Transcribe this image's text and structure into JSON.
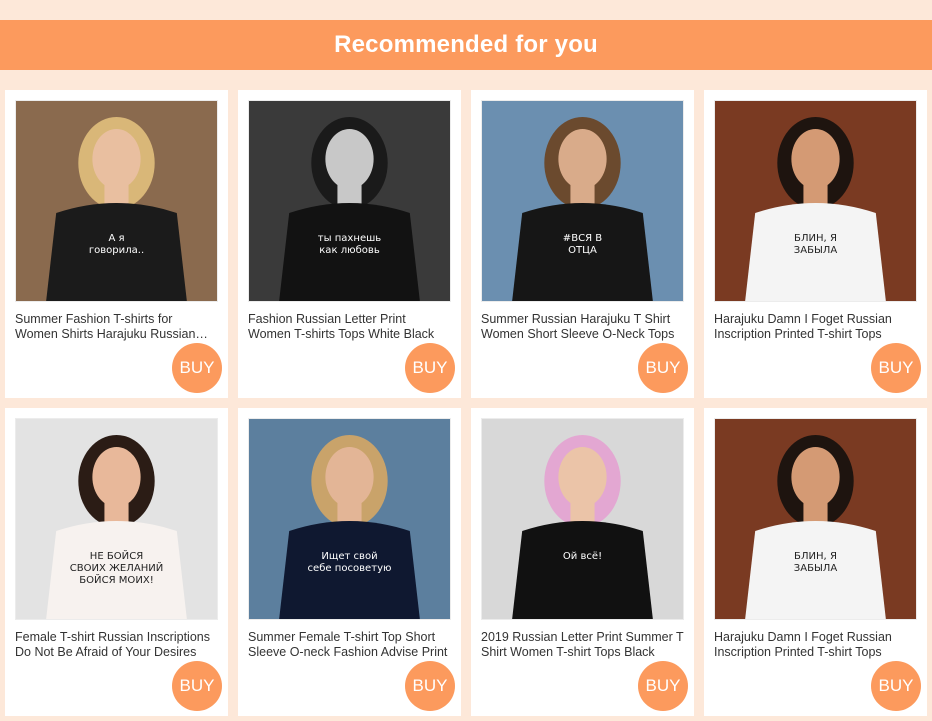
{
  "header": {
    "title": "Recommended for you"
  },
  "products": [
    {
      "title": "Summer Fashion T-shirts for Women Shirts Harajuku Russian Letter Print",
      "buy_label": "BUY",
      "print_text": "А я говорила..",
      "shirt_color": "#1b1b1b",
      "bg_color": "#8a6a4e",
      "skin_color": "#e9bfa0",
      "hair_color": "#d9b778"
    },
    {
      "title": "Fashion Russian Letter Print Women T-shirts Tops White Black",
      "buy_label": "BUY",
      "print_text": "ты пахнешь как любовь",
      "shirt_color": "#121212",
      "bg_color": "#3a3a3a",
      "skin_color": "#c8c8c8",
      "hair_color": "#1a1a1a"
    },
    {
      "title": "Summer Russian Harajuku T Shirt Women Short Sleeve O-Neck Tops",
      "buy_label": "BUY",
      "print_text": "#ВСЯ В ОТЦА",
      "shirt_color": "#161616",
      "bg_color": "#6b8fb0",
      "skin_color": "#d9ab8a",
      "hair_color": "#6b4a2e"
    },
    {
      "title": "Harajuku Damn I Foget Russian Inscription Printed T-shirt Tops",
      "buy_label": "BUY",
      "print_text": "БЛИН, Я ЗАБЫЛА",
      "shirt_color": "#f4f4f4",
      "bg_color": "#7a3a22",
      "skin_color": "#d49a74",
      "hair_color": "#1e140f"
    },
    {
      "title": "Female T-shirt Russian Inscriptions Do Not Be Afraid of Your Desires",
      "buy_label": "BUY",
      "print_text": "НЕ БОЙСЯ СВОИХ ЖЕЛАНИЙ БОЙСЯ МОИХ!",
      "shirt_color": "#f7f2ef",
      "bg_color": "#e3e3e3",
      "skin_color": "#e8b89a",
      "hair_color": "#2b1c15"
    },
    {
      "title": "Summer Female T-shirt Top Short Sleeve O-neck Fashion Advise Print",
      "buy_label": "BUY",
      "print_text": "Ищет свой себе посоветую",
      "shirt_color": "#0f1830",
      "bg_color": "#5c7f9e",
      "skin_color": "#e3b596",
      "hair_color": "#c9a36a"
    },
    {
      "title": "2019 Russian Letter Print Summer T Shirt Women T-shirt Tops Black",
      "buy_label": "BUY",
      "print_text": "Ой всё!",
      "shirt_color": "#111111",
      "bg_color": "#d8d8d8",
      "skin_color": "#ebc4a8",
      "hair_color": "#e3a7d2"
    },
    {
      "title": "Harajuku Damn I Foget Russian Inscription Printed T-shirt Tops",
      "buy_label": "BUY",
      "print_text": "БЛИН, Я ЗАБЫЛА",
      "shirt_color": "#f4f4f4",
      "bg_color": "#7a3a22",
      "skin_color": "#d49a74",
      "hair_color": "#1e140f"
    }
  ],
  "colors": {
    "accent": "#fc9a5d",
    "page_bg": "#fde8d9"
  }
}
